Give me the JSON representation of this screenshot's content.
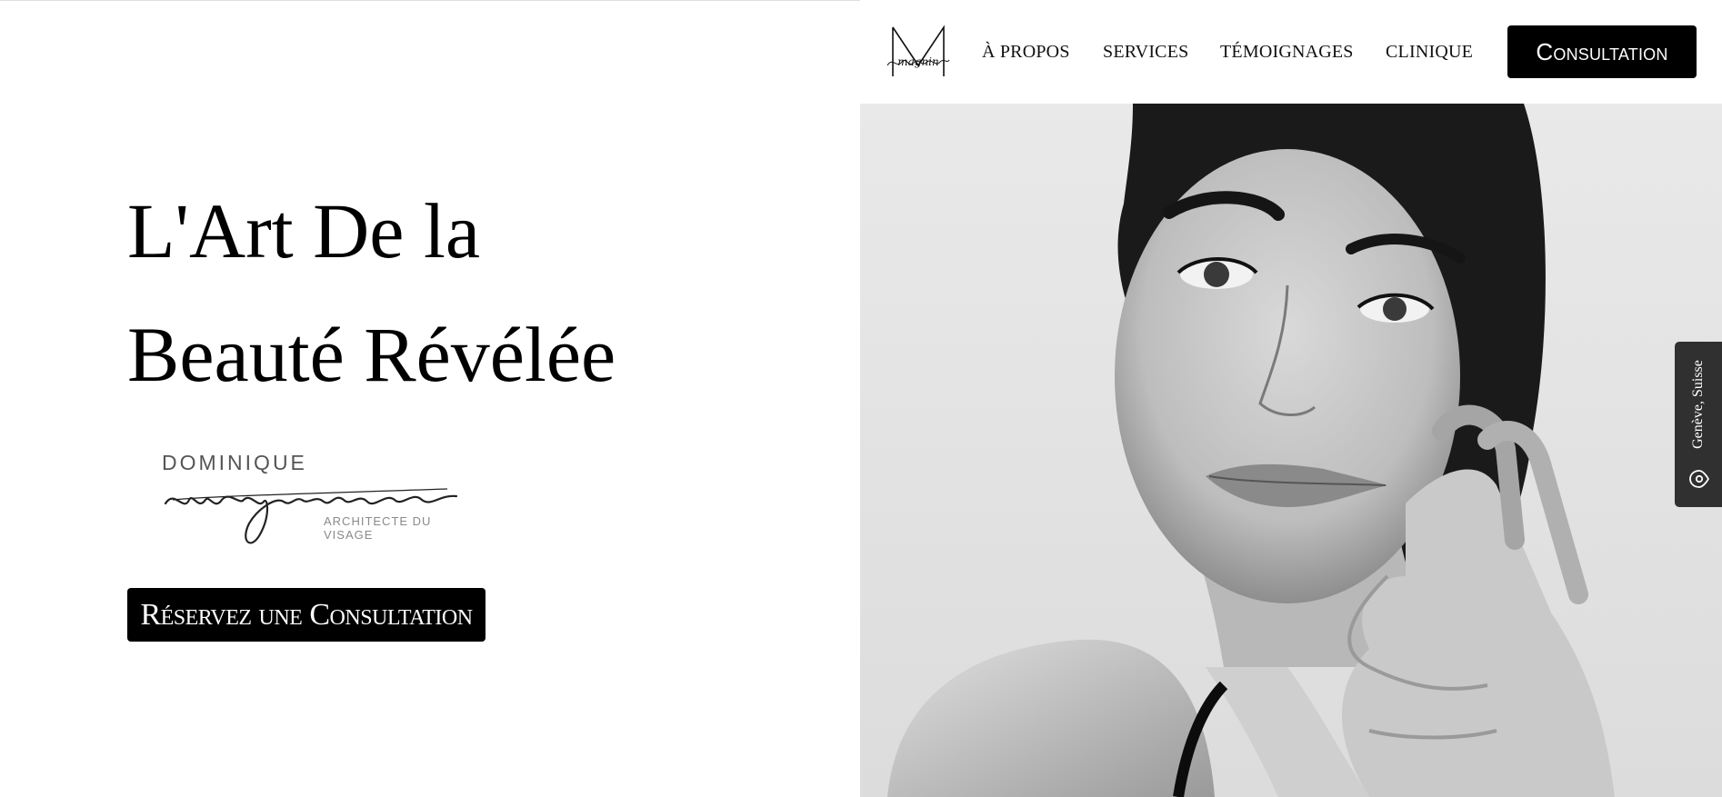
{
  "nav": {
    "items": [
      {
        "label": "À PROPOS"
      },
      {
        "label": "SERVICES"
      },
      {
        "label": "TÉMOIGNAGES"
      },
      {
        "label": "CLINIQUE"
      }
    ],
    "cta_label": "Consultation",
    "logo_text": "magnin"
  },
  "hero": {
    "headline_line1": "L'Art De la",
    "headline_line2": "Beauté Révélée",
    "signature": {
      "top": "DOMINIQUE",
      "script": "magnin",
      "subtitle": "ARCHITECTE DU VISAGE"
    },
    "cta_label": "Réservez une Consultation"
  },
  "location_tab": {
    "label": "Genève, Suisse",
    "icon": "location-pin-icon"
  },
  "colors": {
    "button_bg": "#000000",
    "location_tab_bg": "#303030",
    "text": "#000000"
  }
}
